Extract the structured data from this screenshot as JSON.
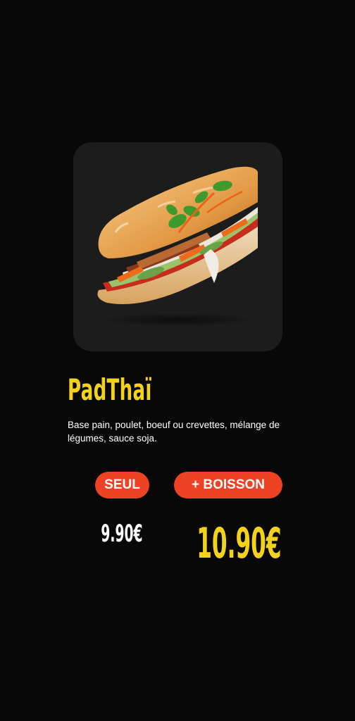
{
  "product": {
    "image_alt": "sandwich-photo",
    "name": "PadThaï",
    "description": "Base pain, poulet, boeuf ou crevettes, mélange de légumes, sauce soja."
  },
  "options": {
    "seul": {
      "label": "SEUL",
      "price": "9.90€"
    },
    "boisson": {
      "label": "+ BOISSON",
      "price": "10.90€"
    }
  },
  "colors": {
    "background": "#080808",
    "card": "#1c1c1c",
    "accent_yellow": "#f2d21b",
    "pill_red": "#ee4224"
  }
}
